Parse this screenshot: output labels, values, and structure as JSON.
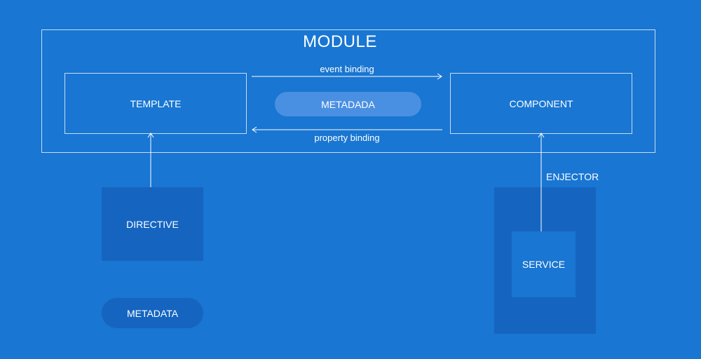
{
  "module": {
    "title": "MODULE"
  },
  "nodes": {
    "template": "TEMPLATE",
    "component": "COMPONENT",
    "metadada": "METADADA",
    "directive": "DIRECTIVE",
    "metadata": "METADATA",
    "service": "SERVICE",
    "injector": "ENJECTOR"
  },
  "edges": {
    "event_binding": "event binding",
    "property_binding": "property binding"
  },
  "colors": {
    "background": "#1976d2",
    "dark_panel": "#1565c0",
    "pill_light": "#4a90e2",
    "line": "#ffffff"
  }
}
